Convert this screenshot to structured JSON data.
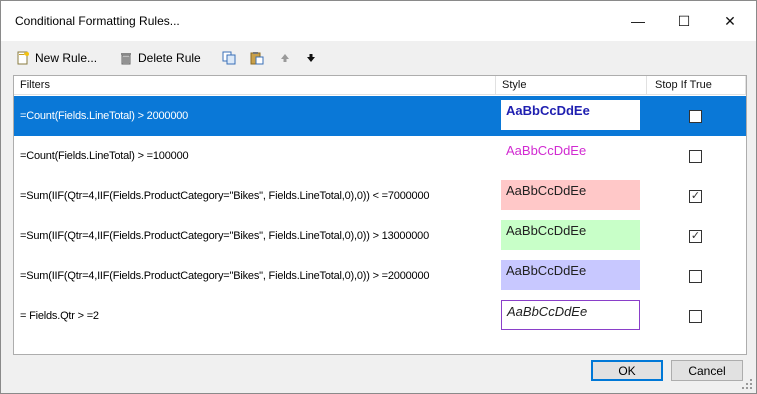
{
  "window": {
    "title": "Conditional Formatting Rules...",
    "minimize": "—",
    "maximize": "☐",
    "close": "✕"
  },
  "toolbar": {
    "new_rule": "New Rule...",
    "delete_rule": "Delete Rule",
    "icons": [
      "new-rule-icon",
      "delete-rule-icon",
      "copy-icon",
      "paste-icon",
      "move-up-icon",
      "move-down-icon"
    ]
  },
  "columns": {
    "filters": "Filters",
    "style": "Style",
    "stop": "Stop If True"
  },
  "rows": [
    {
      "filter": "=Count(Fields.LineTotal) > 2000000",
      "style_text": "AaBbCcDdEe",
      "stop": false,
      "selected": true,
      "fg": "#1f1fb0",
      "bg": "#ffffff",
      "bold": true,
      "italic": false,
      "border": "none"
    },
    {
      "filter": "=Count(Fields.LineTotal) > =100000",
      "style_text": "AaBbCcDdEe",
      "stop": false,
      "selected": false,
      "fg": "#d12ad1",
      "bg": "transparent",
      "bold": false,
      "italic": false,
      "border": "none"
    },
    {
      "filter": "=Sum(IIF(Qtr=4,IIF(Fields.ProductCategory=\"Bikes\", Fields.LineTotal,0),0)) < =7000000",
      "style_text": "AaBbCcDdEe",
      "stop": true,
      "selected": false,
      "fg": "#202020",
      "bg": "#ffc8c8",
      "bold": false,
      "italic": false,
      "border": "none"
    },
    {
      "filter": "=Sum(IIF(Qtr=4,IIF(Fields.ProductCategory=\"Bikes\", Fields.LineTotal,0),0)) > 13000000",
      "style_text": "AaBbCcDdEe",
      "stop": true,
      "selected": false,
      "fg": "#202020",
      "bg": "#c8ffc8",
      "bold": false,
      "italic": false,
      "border": "none"
    },
    {
      "filter": "=Sum(IIF(Qtr=4,IIF(Fields.ProductCategory=\"Bikes\", Fields.LineTotal,0),0)) > =2000000",
      "style_text": "AaBbCcDdEe",
      "stop": false,
      "selected": false,
      "fg": "#202020",
      "bg": "#c8c8ff",
      "bold": false,
      "italic": false,
      "border": "none"
    },
    {
      "filter": "= Fields.Qtr > =2",
      "style_text": "AaBbCcDdEe",
      "stop": false,
      "selected": false,
      "fg": "#202020",
      "bg": "#ffffff",
      "bold": false,
      "italic": true,
      "border": "#8a3fc9"
    }
  ],
  "buttons": {
    "ok": "OK",
    "cancel": "Cancel"
  },
  "checkmark": "✓"
}
